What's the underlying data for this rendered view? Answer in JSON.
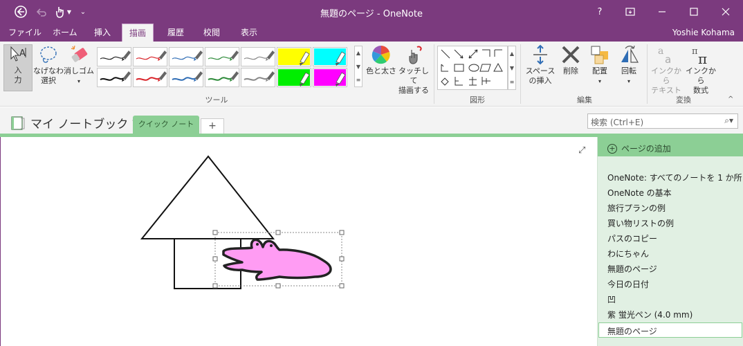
{
  "window": {
    "title": "無題のページ - OneNote",
    "help": "?",
    "user": "Yoshie Kohama"
  },
  "tabs": [
    {
      "label": "ファイル"
    },
    {
      "label": "ホーム"
    },
    {
      "label": "挿入"
    },
    {
      "label": "描画",
      "active": true
    },
    {
      "label": "履歴"
    },
    {
      "label": "校閲"
    },
    {
      "label": "表示"
    }
  ],
  "ribbon": {
    "tools": {
      "input_line1": "入",
      "input_line2": "力",
      "lasso_line1": "なげなわ",
      "lasso_line2": "選択",
      "eraser": "消しゴム",
      "group_label": "ツール"
    },
    "pens_row1": [
      {
        "color": "#222222",
        "kind": "pen"
      },
      {
        "color": "#d9242a",
        "kind": "pen"
      },
      {
        "color": "#2f6db5",
        "kind": "pen"
      },
      {
        "color": "#2e8b3a",
        "kind": "pen"
      },
      {
        "color": "#888888",
        "kind": "pen"
      },
      {
        "color": "#ffff00",
        "kind": "highlighter"
      },
      {
        "color": "#00ffff",
        "kind": "highlighter"
      }
    ],
    "pens_row2": [
      {
        "color": "#111111",
        "kind": "pen"
      },
      {
        "color": "#d9242a",
        "kind": "pen"
      },
      {
        "color": "#2f6db5",
        "kind": "pen"
      },
      {
        "color": "#2e8b3a",
        "kind": "pen"
      },
      {
        "color": "#888888",
        "kind": "pen"
      },
      {
        "color": "#00ee00",
        "kind": "highlighter"
      },
      {
        "color": "#ff00ff",
        "kind": "highlighter"
      }
    ],
    "color_width": "色と太さ",
    "touch_line1": "タッチして",
    "touch_line2": "描画する",
    "shapes_label": "図形",
    "space_line1": "スペース",
    "space_line2": "の挿入",
    "delete": "削除",
    "arrange": "配置",
    "rotate": "回転",
    "edit_label": "編集",
    "ink_text_line1": "インクから",
    "ink_text_line2": "テキスト",
    "ink_math_line1": "インクから",
    "ink_math_line2": "数式",
    "convert_label": "変換"
  },
  "notebook": {
    "name": "マイ ノートブック",
    "section": "クイック ノート",
    "add_tab": "+",
    "search_placeholder": "検索 (Ctrl+E)"
  },
  "pages": {
    "add_page": "ページの追加",
    "items": [
      "OneNote: すべてのノートを 1 か所",
      "OneNote の基本",
      "旅行プランの例",
      "買い物リストの例",
      "パスのコピー",
      "わにちゃん",
      "無題のページ",
      "今日の日付",
      "凹",
      "紫 蛍光ペン (4.0 mm)"
    ],
    "selected": "無題のページ"
  },
  "colors": {
    "brand": "#7b3a7e",
    "section_green": "#8ccf95",
    "pagelist_bg": "#e1f0e3",
    "croc_fill": "#ff9cf3"
  }
}
